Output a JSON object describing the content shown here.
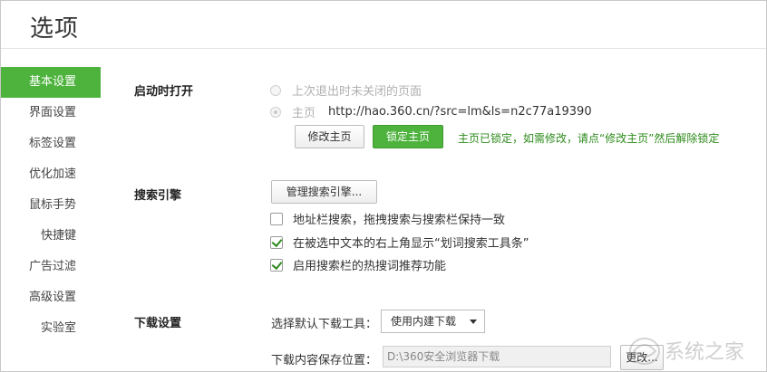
{
  "window": {
    "title": "选项"
  },
  "sidebar": {
    "items": [
      {
        "label": "基本设置",
        "active": true
      },
      {
        "label": "界面设置"
      },
      {
        "label": "标签设置"
      },
      {
        "label": "优化加速"
      },
      {
        "label": "鼠标手势"
      },
      {
        "label": "快捷键"
      },
      {
        "label": "广告过滤"
      },
      {
        "label": "高级设置"
      },
      {
        "label": "实验室"
      }
    ]
  },
  "startup": {
    "label": "启动时打开",
    "option_last": "上次退出时未关闭的页面",
    "option_home": "主页",
    "home_url": "http://hao.360.cn/?src=lm&ls=n2c77a19390",
    "modify_button": "修改主页",
    "lock_button": "锁定主页",
    "lock_hint": "主页已锁定，如需修改，请点“修改主页”然后解除锁定"
  },
  "search": {
    "label": "搜索引擎",
    "manage_button": "管理搜索引擎...",
    "options": [
      {
        "label": "地址栏搜索，拖拽搜索与搜索栏保持一致",
        "checked": false
      },
      {
        "label": "在被选中文本的右上角显示“划词搜索工具条”",
        "checked": true
      },
      {
        "label": "启用搜索栏的热搜词推荐功能",
        "checked": true
      }
    ]
  },
  "download": {
    "label": "下载设置",
    "tool_label": "选择默认下载工具：",
    "tool_value": "使用内建下载",
    "path_label": "下载内容保存位置：",
    "path_value": "D:\\360安全浏览器下载",
    "browse_button": "更改..."
  },
  "colors": {
    "accent": "#4db33d",
    "hint": "#2e8b1c"
  },
  "watermark": {
    "text": "系统之家"
  }
}
